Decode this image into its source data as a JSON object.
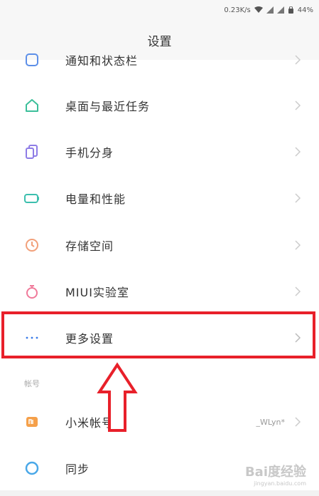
{
  "status_bar": {
    "speed": "0.23K/s",
    "battery": "44%"
  },
  "header": {
    "title": "设置"
  },
  "items": [
    {
      "label": "通知和状态栏",
      "icon": "notification-icon",
      "color": "#5d8fe8"
    },
    {
      "label": "桌面与最近任务",
      "icon": "home-icon",
      "color": "#3cbf9a"
    },
    {
      "label": "手机分身",
      "icon": "dual-phone-icon",
      "color": "#8e7ce6"
    },
    {
      "label": "电量和性能",
      "icon": "battery-icon",
      "color": "#3cbfae"
    },
    {
      "label": "存储空间",
      "icon": "storage-icon",
      "color": "#f2a07a"
    },
    {
      "label": "MIUI实验室",
      "icon": "flask-icon",
      "color": "#f07a9a"
    },
    {
      "label": "更多设置",
      "icon": "more-dots-icon",
      "color": "#3a7be8"
    }
  ],
  "section": {
    "title": "帐号"
  },
  "account_items": [
    {
      "label": "小米帐号",
      "value": "_WLyn*",
      "icon": "mi-account-icon",
      "color": "#f5a04a"
    },
    {
      "label": "同步",
      "icon": "sync-icon",
      "color": "#4aa8e8"
    }
  ],
  "watermark": {
    "text": "Bai度经验",
    "sub": "jingyan.baidu.com"
  },
  "annotation_color": "#e8202a"
}
